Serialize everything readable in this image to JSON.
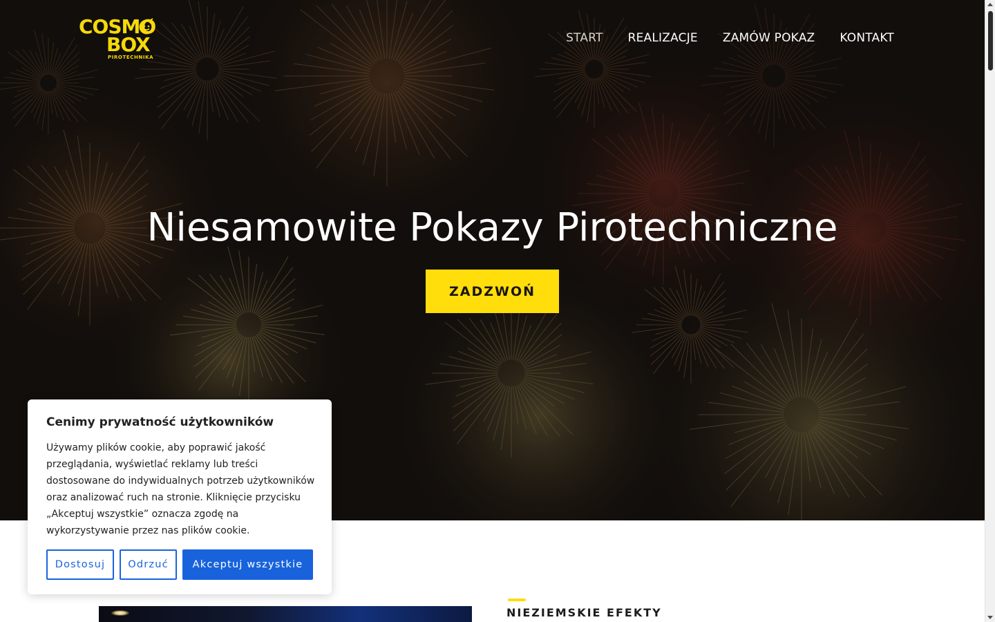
{
  "brand": {
    "logo_line1": "COSMO",
    "logo_line2": "BOX",
    "logo_sub": "PIROTECHNIKA",
    "color": "#ffde0b"
  },
  "nav": {
    "items": [
      {
        "label": "START",
        "active": true
      },
      {
        "label": "REALIZACJE",
        "active": false
      },
      {
        "label": "ZAMÓW POKAZ",
        "active": false
      },
      {
        "label": "KONTAKT",
        "active": false
      }
    ]
  },
  "hero": {
    "title": "Niesamowite Pokazy Pirotechniczne",
    "cta_label": "ZADZWOŃ",
    "background": "fireworks-photo"
  },
  "section": {
    "heading": "NIEZIEMSKIE EFEKTY"
  },
  "cookie": {
    "title": "Cenimy prywatność użytkowników",
    "text": "Używamy plików cookie, aby poprawić jakość przeglądania, wyświetlać reklamy lub treści dostosowane do indywidualnych potrzeb użytkowników oraz analizować ruch na stronie. Kliknięcie przycisku „Akceptuj wszystkie” oznacza zgodę na wykorzystywanie przez nas plików cookie.",
    "customize_label": "Dostosuj",
    "reject_label": "Odrzuć",
    "accept_label": "Akceptuj wszystkie",
    "accent_color": "#1863dc"
  }
}
